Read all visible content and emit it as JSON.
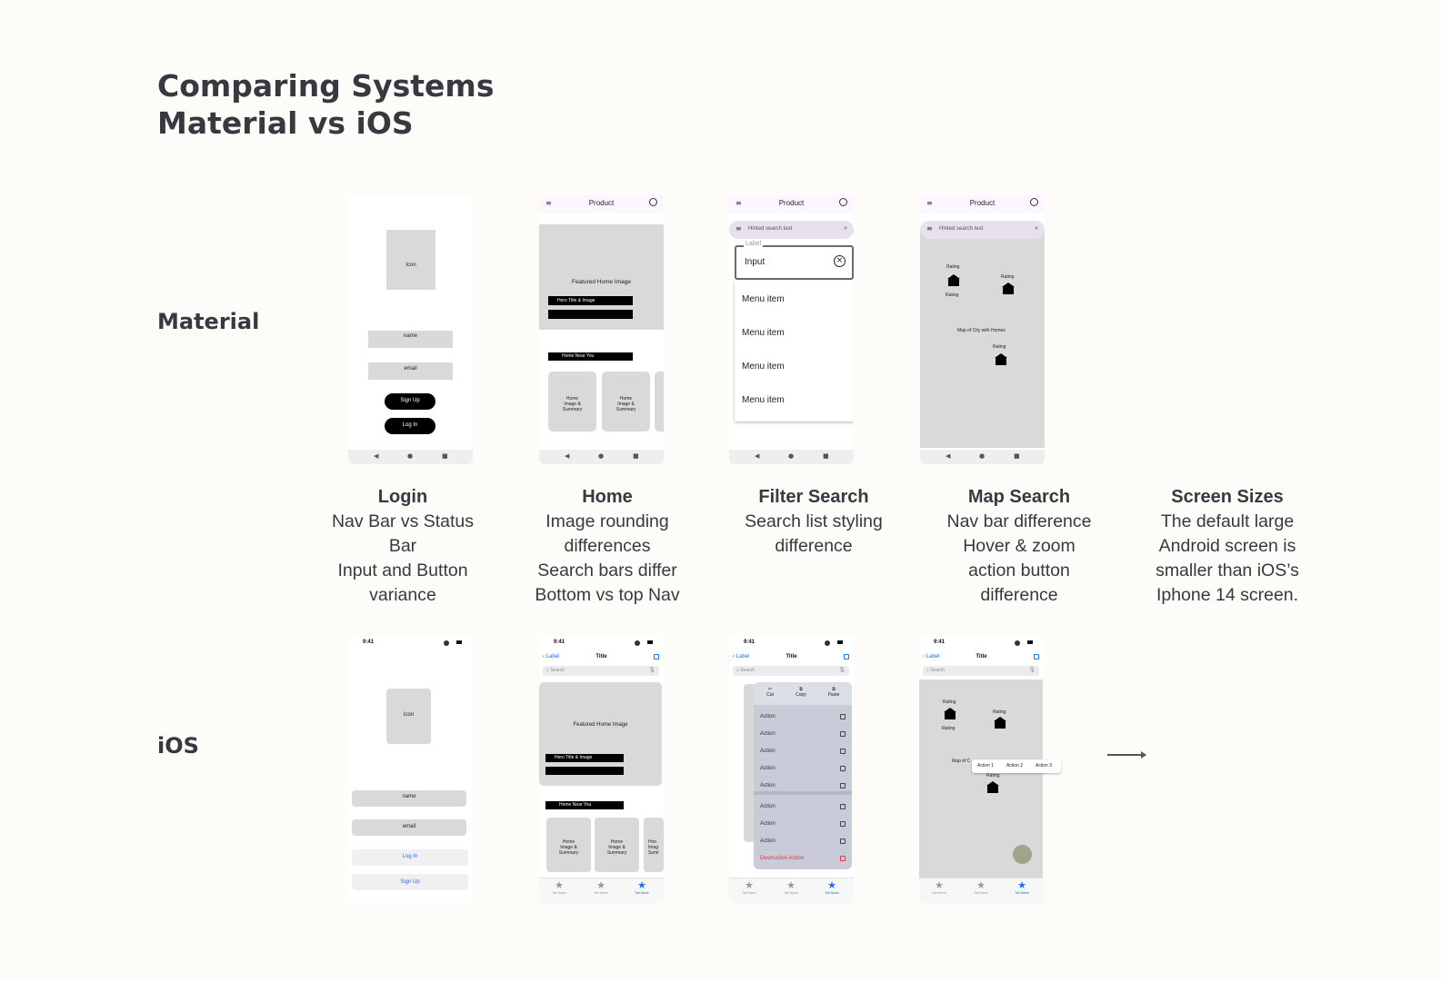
{
  "title": {
    "line1": "Comparing Systems",
    "line2": "Material vs iOS"
  },
  "rows": {
    "material": "Material",
    "ios": "iOS"
  },
  "captions": [
    {
      "title": "Login",
      "lines": [
        "Nav Bar vs Status",
        "Bar",
        "Input and Button",
        "variance"
      ]
    },
    {
      "title": "Home",
      "lines": [
        "Image rounding",
        "differences",
        "Search bars differ",
        "Bottom vs top Nav"
      ]
    },
    {
      "title": "Filter Search",
      "lines": [
        "Search list styling",
        "difference"
      ]
    },
    {
      "title": "Map Search",
      "lines": [
        "Nav bar difference",
        "Hover & zoom",
        "action button",
        "difference"
      ]
    },
    {
      "title": "Screen Sizes",
      "lines": [
        "The default large",
        "Android screen is",
        "smaller than iOS’s",
        "Iphone 14 screen."
      ]
    }
  ],
  "material": {
    "top_bar_title": "Product",
    "search_placeholder": "Hinted search text",
    "login": {
      "icon": "Icon",
      "name": "name",
      "email": "email",
      "signup": "Sign Up",
      "login": "Log In"
    },
    "home": {
      "featured": "Featured Home Image",
      "hero": "Hero Title & Image",
      "near": "Home Near You",
      "card": "Home\nImage &\nSummary"
    },
    "filter": {
      "field_label": "Label",
      "field_value": "Input",
      "menu_items": [
        "Menu item",
        "Menu item",
        "Menu item",
        "Menu item"
      ]
    },
    "map": {
      "ratings": [
        "Rating",
        "Rating",
        "Rating",
        "Rating"
      ],
      "map_label": "Map of City with Homes"
    }
  },
  "ios": {
    "time": "9:41",
    "back_label": "Label",
    "nav_title": "Title",
    "search_placeholder": "Search",
    "tab_label": "Tab Name",
    "login": {
      "icon": "Icon",
      "name": "name",
      "email": "email",
      "login": "Log In",
      "signup": "Sign Up"
    },
    "home": {
      "featured": "Featured Home Image",
      "hero": "Hero Title & Image",
      "near": "Home Near You",
      "card": "Home\nImage &\nSummary",
      "card_partial": "Hon\nImag\nSumr"
    },
    "filter": {
      "edit": [
        "Cut",
        "Copy",
        "Paste"
      ],
      "actions": [
        "Action",
        "Action",
        "Action",
        "Action",
        "Action",
        "Action",
        "Action",
        "Action"
      ],
      "destructive": "Destructive Action"
    },
    "map": {
      "ratings": [
        "Rating",
        "Rating",
        "Rating",
        "Rating"
      ],
      "map_label": "Map of C",
      "actions": [
        "Action 1",
        "Action 2",
        "Action 3"
      ]
    }
  },
  "colors": {
    "background": "#fdfcf8",
    "text": "#363a40",
    "ios_blue": "#1a73e8",
    "destructive": "#e53935"
  }
}
